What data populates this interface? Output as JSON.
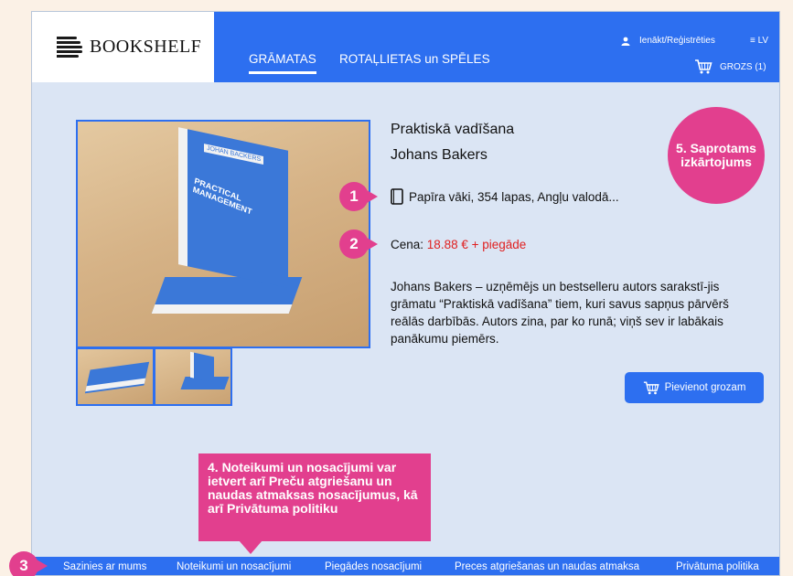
{
  "header": {
    "logo_text": "BOOKSHELF",
    "nav_tabs": [
      {
        "label": "GRĀMATAS",
        "active": true
      },
      {
        "label": "ROTAĻLIETAS un SPĒLES",
        "active": false
      }
    ],
    "login_label": "Ienākt/Reģistrēties",
    "language": "≡ LV",
    "cart_label": "GROZS (1)"
  },
  "product": {
    "title": "Praktiskā vadīšana",
    "author": "Johans Bakers",
    "spec": "Papīra vāki, 354 lapas, Angļu valodā...",
    "price_label": "Cena:",
    "price_value": "18.88 € + piegāde",
    "description": "Johans Bakers – uzņēmējs un bestselleru autors sarakstī-jis grāmatu “Praktiskā vadīšana” tiem, kuri savus sapņus pārvērš reālās darbībās. Autors zina, par ko runā; viņš sev ir labākais panākumu piemērs.",
    "add_to_cart": "Pievienot grozam",
    "book_cover_text": "PRACTICAL MANAGEMENT",
    "book_cover_author": "JOHAN BACKERS"
  },
  "footer": {
    "links": [
      "Sazinies ar mums",
      "Noteikumi un nosacījumi",
      "Piegādes nosacījumi",
      "Preces atgriešanas un naudas atmaksa",
      "Privātuma politika"
    ]
  },
  "annotations": {
    "badge1": "1",
    "badge2": "2",
    "badge3": "3",
    "callout4": "4. Noteikumi un nosacījumi var ietvert arī Preču atgriešanu un naudas atmaksas nosacījumus, kā arī Privātuma politiku",
    "callout5": "5. Saprotams izkārtojums"
  },
  "colors": {
    "primary": "#2d6ff0",
    "accent": "#e23f8e",
    "price": "#e02020",
    "background": "#dbe5f4"
  }
}
